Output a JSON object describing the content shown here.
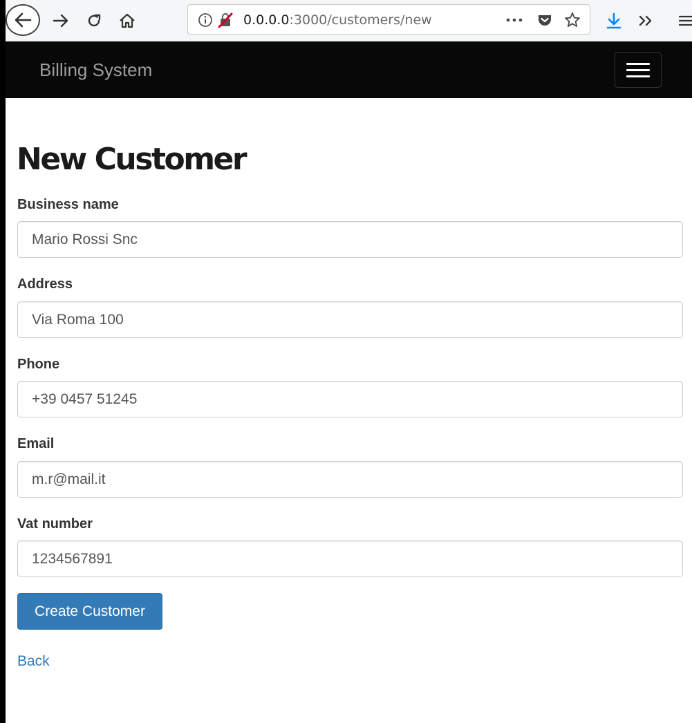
{
  "browser": {
    "url_host": "0.0.0.0",
    "url_path": ":3000/customers/new",
    "more_icon": "more-horizontal-icon",
    "colors": {
      "download_accent": "#0a84ff",
      "insecure_accent": "#d70022"
    }
  },
  "navbar": {
    "brand": "Billing System",
    "background": "#080808"
  },
  "page": {
    "title": "New Customer"
  },
  "form": {
    "fields": [
      {
        "label": "Business name",
        "value": "Mario Rossi Snc"
      },
      {
        "label": "Address",
        "value": "Via Roma 100"
      },
      {
        "label": "Phone",
        "value": "+39 0457 51245"
      },
      {
        "label": "Email",
        "value": "m.r@mail.it"
      },
      {
        "label": "Vat number",
        "value": "1234567891"
      }
    ],
    "submit_label": "Create Customer",
    "submit_color": "#337ab7"
  },
  "links": {
    "back": "Back"
  }
}
